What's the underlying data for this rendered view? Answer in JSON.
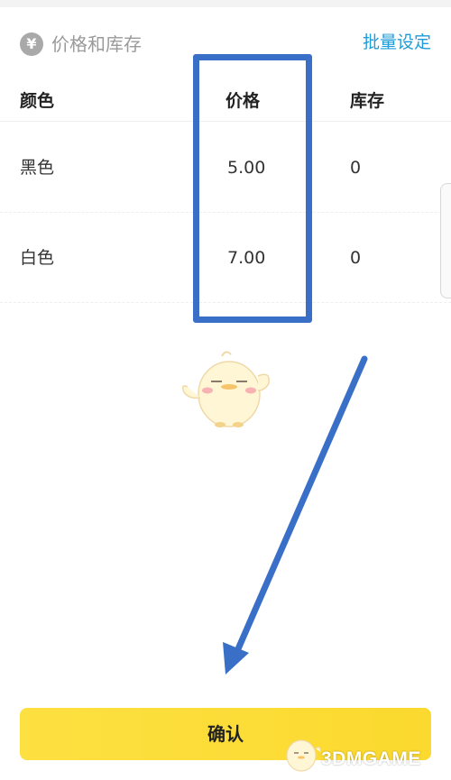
{
  "section": {
    "icon": "yen-icon",
    "title": "价格和库存",
    "batch_link": "批量设定"
  },
  "table": {
    "headers": [
      "颜色",
      "价格",
      "库存"
    ],
    "rows": [
      {
        "color": "黑色",
        "price": "5.00",
        "stock": "0"
      },
      {
        "color": "白色",
        "price": "7.00",
        "stock": "0"
      }
    ]
  },
  "footer": {
    "confirm_label": "确认"
  },
  "watermark": {
    "text": "3DMGAME"
  },
  "colors": {
    "accent_link": "#1f9bd8",
    "confirm_bg": "#fbd92e",
    "annotation_blue": "#3a6fc7"
  }
}
